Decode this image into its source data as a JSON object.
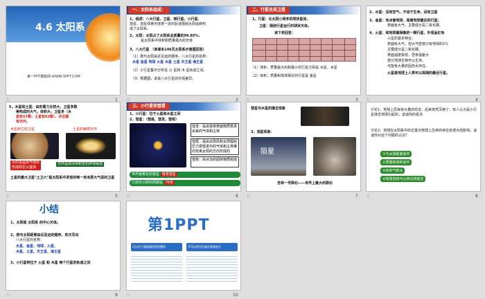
{
  "slides": [
    {
      "num": "1",
      "title": "4.6  太阳系",
      "site": "第一PPT模板网-WWW.1PPT.COM"
    },
    {
      "num": "2",
      "header": "一、太阳系组成：",
      "l1": "1，组成：八大行星、卫星、矮行星、小行星、",
      "l1b": "彗星、流星体等天体按一定的轨道围绕太阳运转构",
      "l1c": "成了太阳系。",
      "l2": "2，太阳：太阳占了太阳系总质量的99.85%，",
      "l2b": "是太阳系中体积和质量最大的天体",
      "l3": "3，八大行星 （读课本146页太阳系示意图回答）",
      "l3a": "（1）按与太阳由近及远的顺序，八大行星的名称：",
      "planets": "水星  金星  地球  火星  木星  土星  天王星  海王星",
      "l3b": "（2）小行星集中分布在  火 星和  木 星轨道之间。",
      "l3c": "（3）根据图，说说八大行星的外观差异。"
    },
    {
      "num": "3",
      "header": "二、行星及其卫星",
      "l1": "1，行星：比太阳小得多的球状星体，",
      "l2": "卫星：围绕行星运行的球状天体。",
      "l3": "读下表回答：",
      "q1": "（1）体积、质量最大的和最小的行星分别是 木星、水星",
      "q2": "（2）体积、质量和地球相近的行星是 金星"
    },
    {
      "num": "4",
      "p2": "2，水星：没有空气、不适于生命，没有卫星",
      "p3": "3，金星：有点像地球，是离地球最近的行星；",
      "p3b": "表面有大气，主要成分是二氧化碳。",
      "p4": "4，火星：和地球最相像的一颗行星，外观呈红色",
      "p4b": "火星的基本特征：",
      "p4c": "表面有大气，但大气密度只有地球的1%",
      "p4d": "主要成分是二氧化碳。",
      "p4e": "表面温度极低，昼夜温差大",
      "p4f": "部分地球生物可以生存。",
      "p4g": "可能有大量的固态水存在。",
      "p4h": "火星是地球上人类可以探测的最近行星。"
    },
    {
      "num": "5",
      "l1": "5，木星和土星：由的重力比较大，卫星多数",
      "l1b": "等构成的大气，体积大，卫星多（木",
      "l1c": "星有67颗，土星有62颗），并且都",
      "l1d": "有光环。",
      "cap1": "木星和它的卫星",
      "cap2": "土星的美丽光环",
      "tag1": "大红斑是由气体所",
      "tag1b": "形成的巨大漩涡",
      "tag2": "光环是由冰块和岩石碎块组成",
      "bottom": "土星的最大卫星\"土卫六\"是太阳系中发现的唯一有浓厚大气层的卫星"
    },
    {
      "num": "6",
      "header": "三、小行星和彗星",
      "l1": "1，小行星：位于火星和木星之间",
      "l2": "2，彗星：（彗尾、彗发、彗核）",
      "b1": "彗发：是由彗核表面物质蒸发出来的气体和尘埃",
      "b2": "彗尾：是由太阳风和太阳辐射压力把彗发中的气体和尘埃推向背离太阳的方向形成的",
      "b3": "彗核：由冰冻的固体物质组成",
      "g1": "世界最著名的彗星",
      "g1r": "哈雷彗星",
      "g2": "它绕日公转的周期是",
      "g2r": "76年"
    },
    {
      "num": "7",
      "l1": "彗星与木星的撞击现象",
      "l2": "3，流星现象：",
      "meteor": "陨星",
      "cap": "吉林一号陨石——世界上最大的陨石"
    },
    {
      "num": "8",
      "d1": "讨论1：地球上原来有大量的恐龙，后来突然灭绝了，有人认为是小行星撞击地球引起的，谈谈你的看法",
      "d2": "讨论2：地球在太阳系中的位置对地球上生命的存在有很大的影响，谈谈你对这个问题的认识？",
      "o1": "①与太阳距离适中",
      "o2": "②质量和体积适中",
      "o3": "③有氧气和水",
      "o4": "④地球自转与公转比较稳定"
    },
    {
      "num": "9",
      "title": "小结",
      "l1": "1，太阳是  太阳系  的中心天体。",
      "l2": "2，按与太阳距离由近及远的顺序，依次写出",
      "l2b": "八大行星的名称：",
      "l2c": "水星、金星、地球、火星、",
      "l2d": "木星、土星、天王星、海王星",
      "l3": "3，小行星带位于  火星  和  木星  两个行星的轨道之间"
    },
    {
      "num": "10",
      "logo": "第1PPT",
      "b1": "可以在下面链接找到免费的",
      "b2": "不可以把它们放在其他地方"
    }
  ]
}
